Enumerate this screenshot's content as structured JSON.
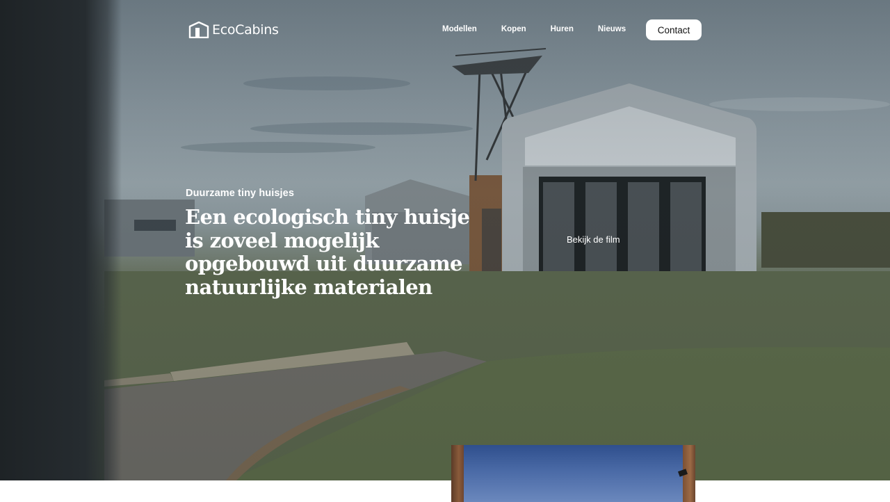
{
  "brand": {
    "name": "EcoCabins",
    "logo_icon": "house-icon"
  },
  "nav": {
    "items": [
      {
        "label": "Modellen"
      },
      {
        "label": "Kopen"
      },
      {
        "label": "Huren"
      },
      {
        "label": "Nieuws"
      }
    ],
    "contact_label": "Contact"
  },
  "hero": {
    "eyebrow": "Duurzame tiny huisjes",
    "headline": "Een ecologisch tiny huisje is zoveel mogelijk opgebouwd uit duurzame natuurlijke materialen",
    "film_link": "Bekijk de film"
  },
  "colors": {
    "text": "#ffffff",
    "button_bg": "#ffffff",
    "button_text": "#111111"
  }
}
